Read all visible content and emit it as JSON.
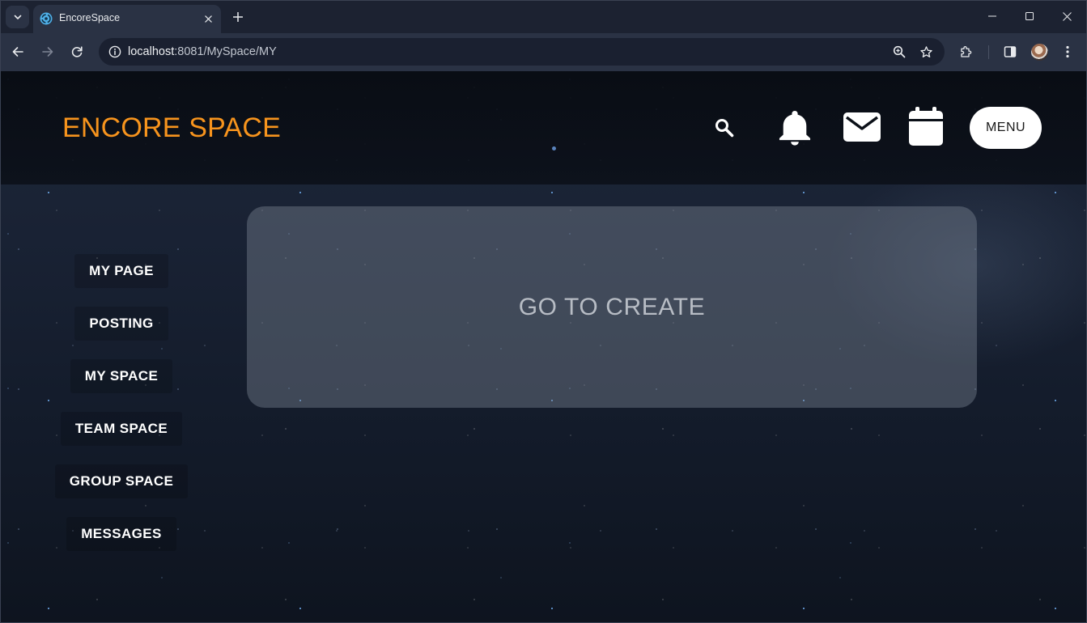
{
  "browser": {
    "tab_search_icon": "chevron-down-icon",
    "tab": {
      "favicon": "encore-space-favicon",
      "title": "EncoreSpace",
      "close_icon": "close-icon"
    },
    "new_tab_icon": "plus-icon",
    "window_controls": [
      "minimize-icon",
      "maximize-icon",
      "close-icon"
    ],
    "nav": {
      "back_icon": "arrow-left-icon",
      "forward_icon": "arrow-right-icon",
      "reload_icon": "reload-icon"
    },
    "address": {
      "info_icon": "info-icon",
      "host": "localhost",
      "path": ":8081/MySpace/MY",
      "zoom_icon": "zoom-icon",
      "bookmark_icon": "star-icon"
    },
    "toolbar_icons": [
      "extensions-icon",
      "side-panel-icon",
      "profile-avatar",
      "kebab-menu-icon"
    ]
  },
  "header": {
    "logo": "ENCORE SPACE",
    "icons": [
      "search-icon",
      "bell-icon",
      "mail-icon",
      "calendar-icon"
    ],
    "menu_label": "MENU"
  },
  "sidebar": {
    "items": [
      {
        "label": "MY PAGE"
      },
      {
        "label": "POSTING"
      },
      {
        "label": "MY SPACE"
      },
      {
        "label": "TEAM SPACE"
      },
      {
        "label": "GROUP SPACE"
      },
      {
        "label": "MESSAGES"
      }
    ]
  },
  "main": {
    "create_card_label": "GO TO CREATE"
  },
  "colors": {
    "logo": "#f7941d",
    "page_background": "#192234",
    "header_background": "#0a0e16",
    "card_text": "#b7bcc4",
    "menu_button_background": "#ffffff",
    "browser_frame": "#1c2231"
  }
}
